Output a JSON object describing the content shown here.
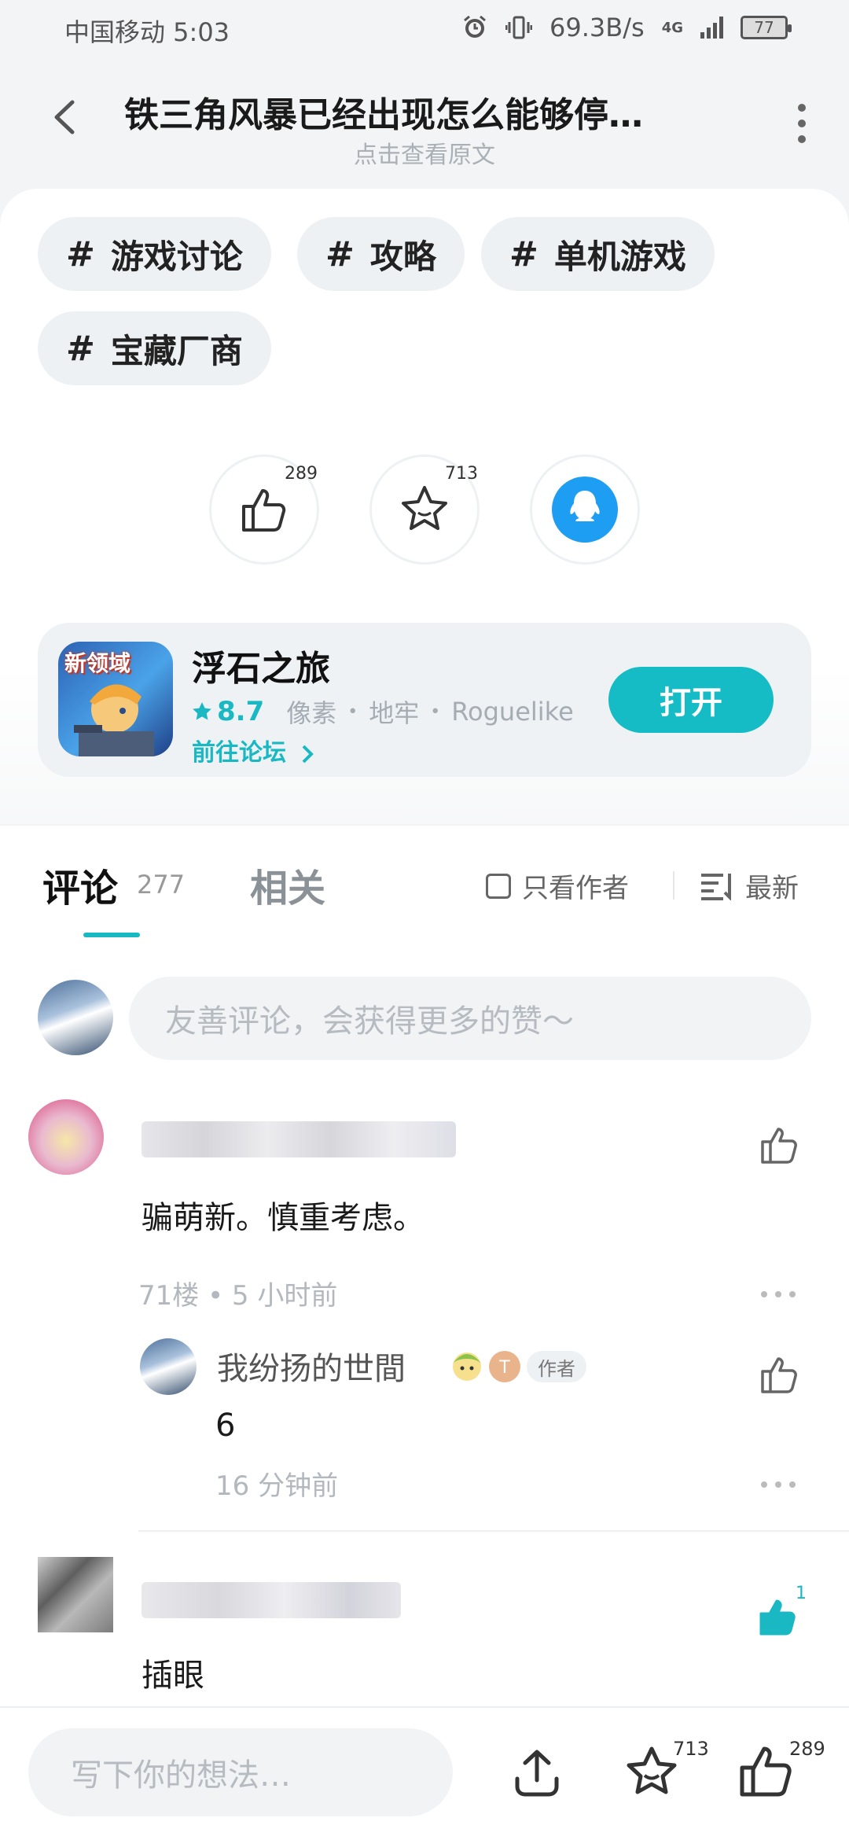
{
  "status_bar": {
    "carrier_time": "中国移动 5:03",
    "network_speed": "69.3B/s",
    "network_type": "4G",
    "battery": "77"
  },
  "header": {
    "title": "铁三角风暴已经出现怎么能够停…",
    "subtitle": "点击查看原文"
  },
  "tags": [
    {
      "hash": "#",
      "label": "游戏讨论"
    },
    {
      "hash": "#",
      "label": "攻略"
    },
    {
      "hash": "#",
      "label": "单机游戏"
    },
    {
      "hash": "#",
      "label": "宝藏厂商"
    }
  ],
  "actions": {
    "like_count": "289",
    "favorite_count": "713"
  },
  "app": {
    "icon_text": "新领域",
    "name": "浮石之旅",
    "rating": "8.7",
    "tags": [
      "像素",
      "地牢",
      "Roguelike"
    ],
    "dot": "•",
    "forum_link": "前往论坛",
    "open_label": "打开",
    "accent_color": "#16bcc5"
  },
  "comments_section": {
    "tab_comments": "评论",
    "comment_count": "277",
    "tab_related": "相关",
    "only_author": "只看作者",
    "sort": "最新",
    "input_placeholder": "友善评论，会获得更多的赞～",
    "items": [
      {
        "text": "骗萌新。慎重考虑。",
        "meta": "71楼 • 5 小时前",
        "reply": {
          "name": "我纷扬的世間",
          "author_badge": "作者",
          "text": "6",
          "meta": "16 分钟前"
        }
      },
      {
        "text": "插眼",
        "like_count": "1"
      }
    ]
  },
  "bottom_bar": {
    "placeholder": "写下你的想法…",
    "favorite_count": "713",
    "like_count": "289"
  }
}
